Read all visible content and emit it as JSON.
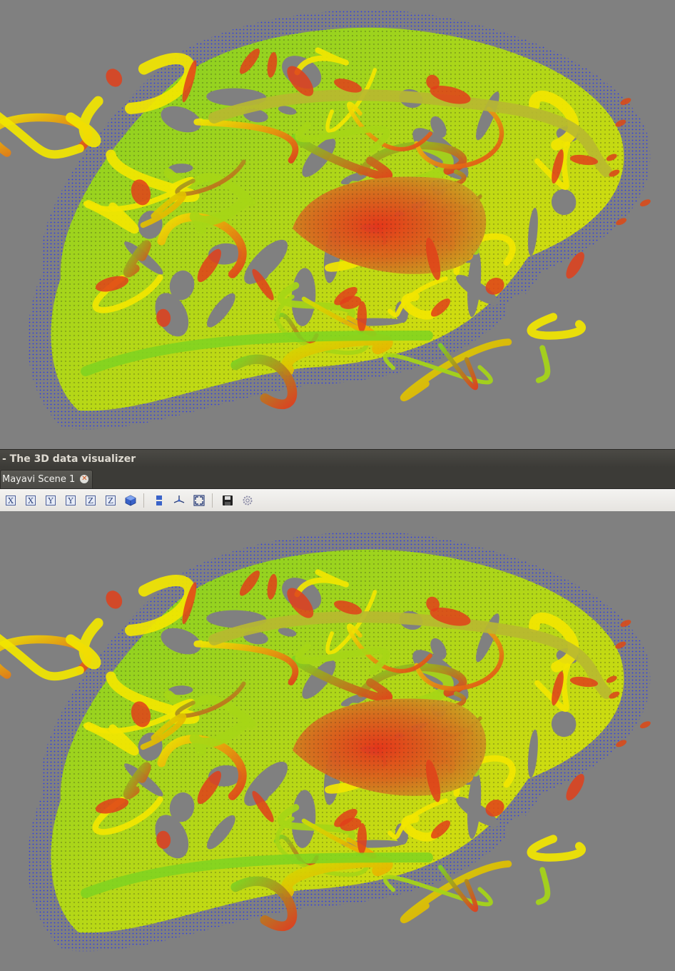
{
  "window": {
    "title": "- The 3D data visualizer"
  },
  "tabs": [
    {
      "label": "Mayavi Scene 1",
      "close_icon": "close-icon"
    }
  ],
  "toolbar": {
    "buttons": [
      {
        "name": "view-minus-x",
        "glyph": "X",
        "icon": "x-axis-view-icon"
      },
      {
        "name": "view-plus-x",
        "glyph": "X",
        "icon": "x-axis-view-icon"
      },
      {
        "name": "view-minus-y",
        "glyph": "Y",
        "icon": "y-axis-view-icon"
      },
      {
        "name": "view-plus-y",
        "glyph": "Y",
        "icon": "y-axis-view-icon"
      },
      {
        "name": "view-minus-z",
        "glyph": "Z",
        "icon": "z-axis-view-icon"
      },
      {
        "name": "view-plus-z",
        "glyph": "Z",
        "icon": "z-axis-view-icon"
      },
      {
        "name": "isometric-view",
        "icon": "cube-icon"
      },
      {
        "name": "parallel-projection",
        "icon": "projection-icon"
      },
      {
        "name": "axes-indicator",
        "icon": "axes-icon"
      },
      {
        "name": "full-screen",
        "icon": "fullscreen-icon"
      },
      {
        "name": "save-scene",
        "icon": "save-icon"
      },
      {
        "name": "configure-scene",
        "icon": "gear-icon"
      }
    ]
  },
  "scenes": [
    {
      "name": "scene-top",
      "description": "3D brain fiber surface render"
    },
    {
      "name": "scene-bottom",
      "description": "3D brain fiber surface render"
    }
  ],
  "colors": {
    "background": "#808080",
    "point_cloud": "#1a2cff",
    "surface_low": "#7ed321",
    "surface_mid": "#f2e600",
    "surface_high": "#e0401a"
  }
}
